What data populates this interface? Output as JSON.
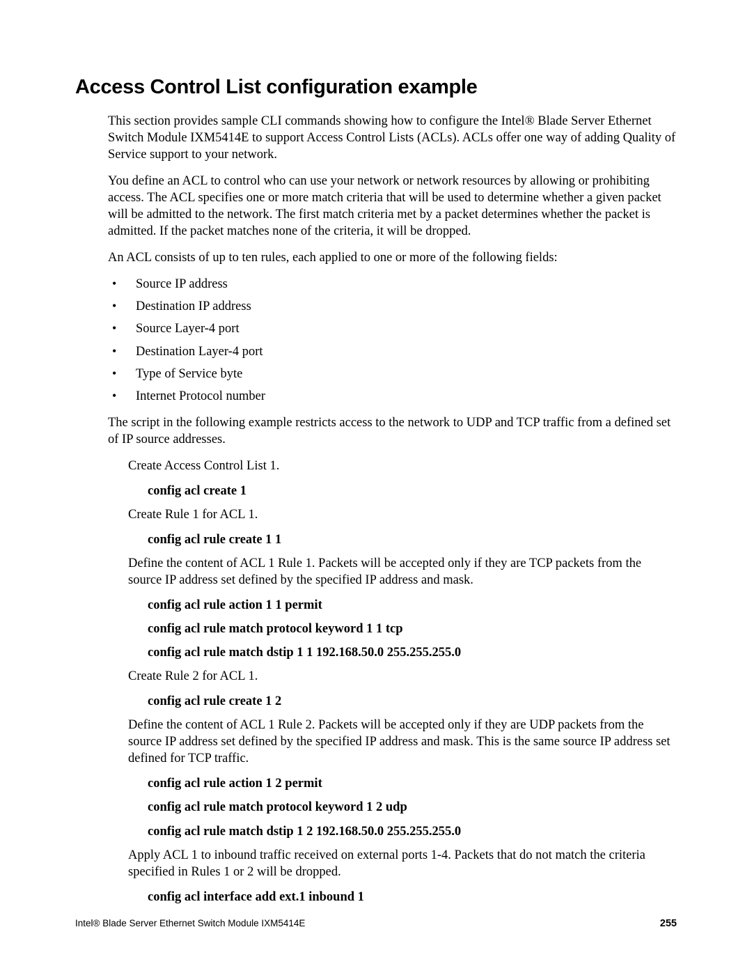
{
  "title": "Access Control List configuration example",
  "paragraphs": {
    "intro1": "This section provides sample CLI commands showing how to configure the Intel® Blade Server Ethernet Switch Module IXM5414E to support Access Control Lists (ACLs). ACLs offer one way of adding Quality of Service support to your network.",
    "intro2": "You define an ACL to control who can use your network or network resources by allowing or prohibiting access. The ACL specifies one or more match criteria that will be used to determine whether a given packet will be admitted to the network. The first match criteria met by a packet determines whether the packet is admitted. If the packet matches none of the criteria, it will be dropped.",
    "fieldsIntro": "An ACL consists of up to ten rules, each applied to one or more of the following fields:",
    "scriptIntro": "The script in the following example restricts access to the network to UDP and TCP traffic from a defined set of IP source addresses."
  },
  "fields": [
    "Source IP address",
    "Destination IP address",
    "Source Layer-4 port",
    "Destination Layer-4 port",
    "Type of Service byte",
    "Internet Protocol number"
  ],
  "steps": {
    "createAcl": "Create Access Control List 1.",
    "createRule1": "Create Rule 1 for ACL 1.",
    "defineRule1": "Define the content of ACL 1 Rule 1. Packets will be accepted only if they are TCP packets from the source IP address set defined by the specified IP address and mask.",
    "createRule2": "Create Rule 2 for ACL 1.",
    "defineRule2": "Define the content of ACL 1 Rule 2. Packets will be accepted only if they are UDP packets from the source IP address set defined by the specified IP address and mask. This is the same source IP address set defined for TCP traffic.",
    "applyAcl": "Apply ACL 1 to inbound traffic received on external ports 1-4. Packets that do not match the criteria specified in Rules 1 or 2 will be dropped."
  },
  "commands": {
    "cmd1": "config acl create 1",
    "cmd2": "config acl rule create 1 1",
    "cmd3": "config acl rule action 1 1 permit",
    "cmd4": "config acl rule match protocol keyword 1 1 tcp",
    "cmd5": "config acl rule match dstip 1 1 192.168.50.0 255.255.255.0",
    "cmd6": "config acl rule create 1 2",
    "cmd7": "config acl rule action 1 2 permit",
    "cmd8": "config acl rule match protocol keyword 1 2 udp",
    "cmd9": "config acl rule match dstip 1 2 192.168.50.0 255.255.255.0",
    "cmd10": "config acl interface add ext.1 inbound 1"
  },
  "footer": {
    "left": "Intel® Blade Server Ethernet Switch Module IXM5414E",
    "right": "255"
  }
}
